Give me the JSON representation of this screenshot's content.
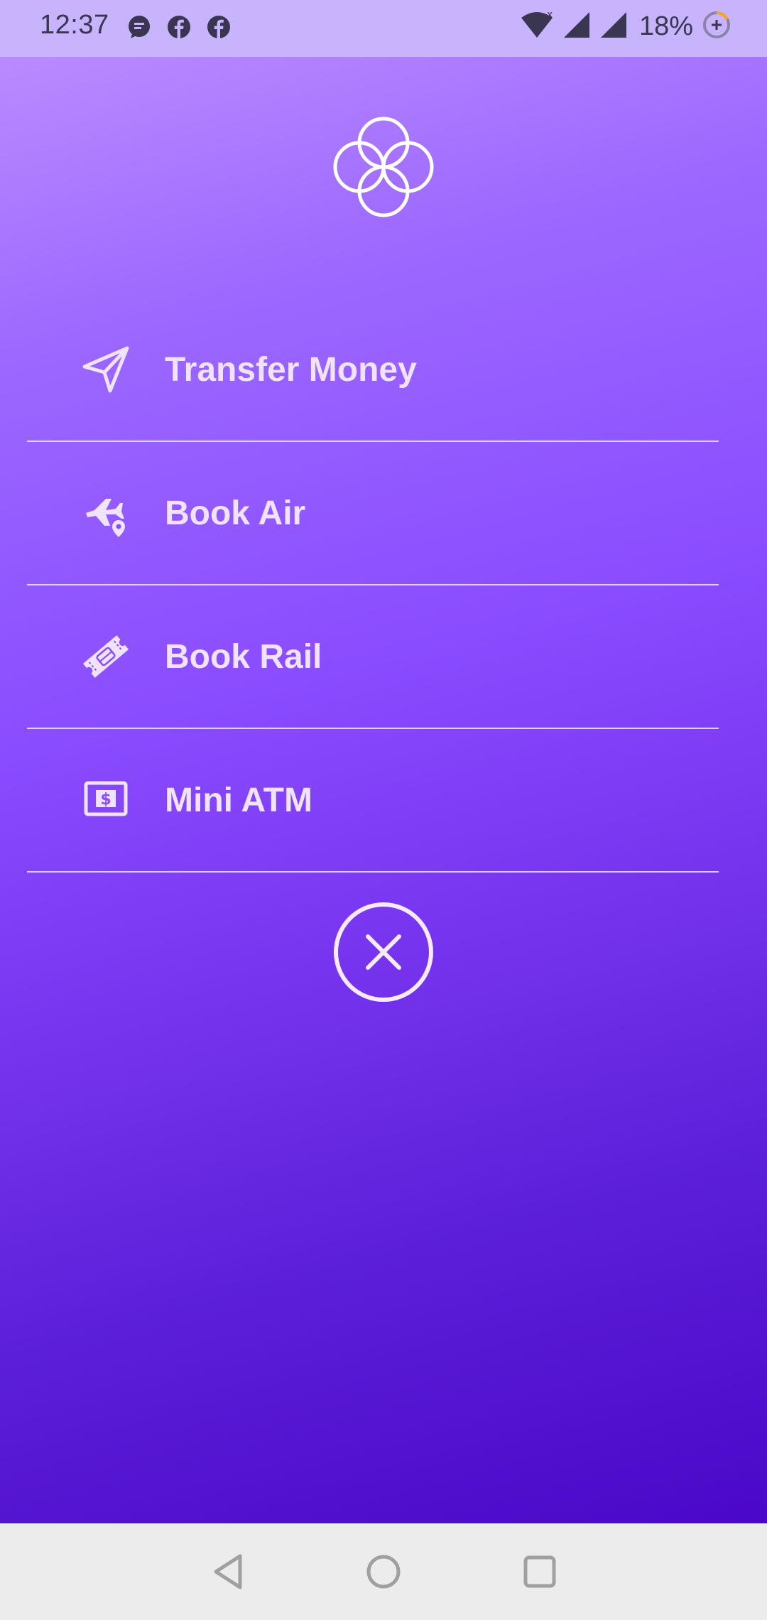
{
  "status_bar": {
    "time": "12:37",
    "notification_icons": [
      "chat-bubble-icon",
      "facebook-icon",
      "facebook-icon"
    ],
    "signal_icons": [
      "wifi-icon",
      "cell-signal-icon",
      "cell-signal-icon"
    ],
    "battery_text": "18%",
    "battery_icon": "battery-saver-icon"
  },
  "logo": {
    "icon": "interlocking-circles-logo-icon"
  },
  "menu": {
    "items": [
      {
        "label": "Transfer Money",
        "icon": "paper-plane-icon"
      },
      {
        "label": "Book Air",
        "icon": "airplane-location-icon"
      },
      {
        "label": "Book Rail",
        "icon": "train-ticket-icon"
      },
      {
        "label": "Mini ATM",
        "icon": "cash-dollar-icon"
      }
    ]
  },
  "close": {
    "icon": "close-circle-icon"
  },
  "nav_bar": {
    "back_icon": "back-triangle-icon",
    "home_icon": "home-circle-icon",
    "recents_icon": "recents-square-icon"
  },
  "colors": {
    "status_bar_bg": "#c8b4fc",
    "gradient_top": "#b98bff",
    "gradient_bottom": "#4a07c8",
    "menu_text": "#efe3ff",
    "nav_bar_bg": "#ececec"
  }
}
